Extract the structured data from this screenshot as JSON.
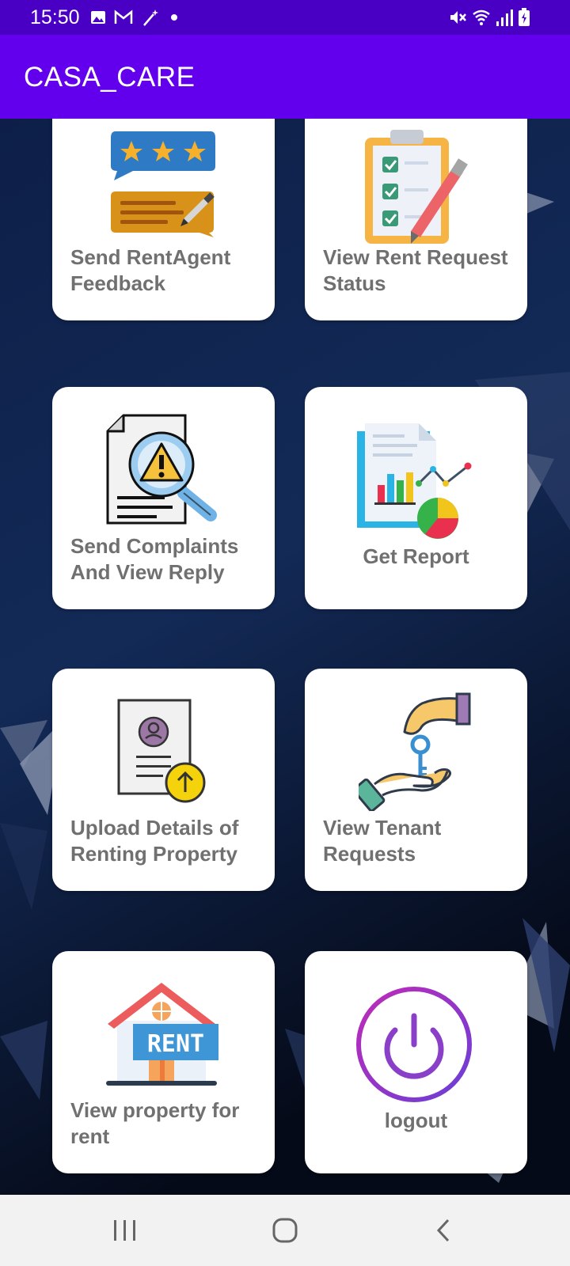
{
  "status_bar": {
    "time": "15:50",
    "left_icons": [
      "image-icon",
      "gmail-icon",
      "magic-wand-icon",
      "dot-icon"
    ],
    "right_icons": [
      "mute-icon",
      "wifi-icon",
      "signal-icon",
      "battery-icon"
    ]
  },
  "app_bar": {
    "title": "CASA_CARE"
  },
  "cards": [
    {
      "label": "Send RentAgent Feedback",
      "icon": "feedback-icon"
    },
    {
      "label": "View Rent Request Status",
      "icon": "clipboard-checklist-icon"
    },
    {
      "label": "Send Complaints And View Reply",
      "icon": "complaint-magnifier-icon"
    },
    {
      "label": "Get Report",
      "icon": "report-chart-icon"
    },
    {
      "label": "Upload Details of Renting Property",
      "icon": "upload-document-icon"
    },
    {
      "label": "View Tenant Requests",
      "icon": "key-handover-icon"
    },
    {
      "label": "View property for rent",
      "icon": "house-rent-icon",
      "sign_text": "RENT"
    },
    {
      "label": "logout",
      "icon": "power-icon"
    }
  ],
  "nav_bar": {
    "items": [
      "recent-apps-icon",
      "home-icon",
      "back-icon"
    ]
  },
  "colors": {
    "status_bar": "#4a00c4",
    "app_bar": "#6200ee",
    "label": "#707070"
  }
}
